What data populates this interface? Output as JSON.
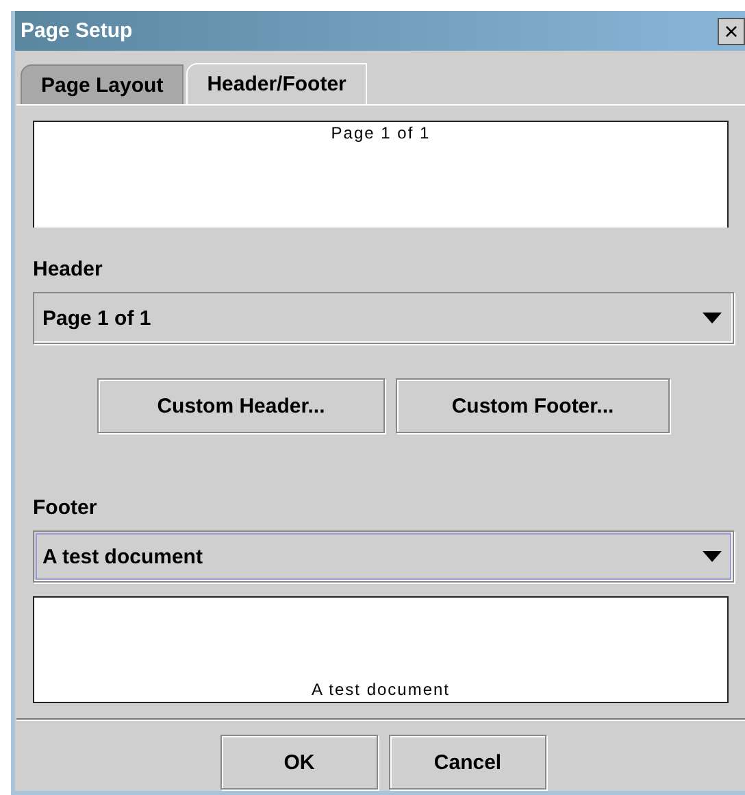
{
  "window": {
    "title": "Page Setup",
    "close": "×"
  },
  "tabs": [
    {
      "label": "Page Layout",
      "selected": false
    },
    {
      "label": "Header/Footer",
      "selected": true
    }
  ],
  "header_preview": {
    "text": "Page 1 of 1"
  },
  "header": {
    "label": "Header",
    "value": "Page 1 of 1",
    "focused": false
  },
  "buttons_custom": [
    "Custom Header...",
    "Custom Footer..."
  ],
  "footer": {
    "label": "Footer",
    "value": "A test document",
    "focused": true
  },
  "footer_preview": {
    "text": "A test document"
  },
  "buttons": [
    "OK",
    "Cancel"
  ]
}
